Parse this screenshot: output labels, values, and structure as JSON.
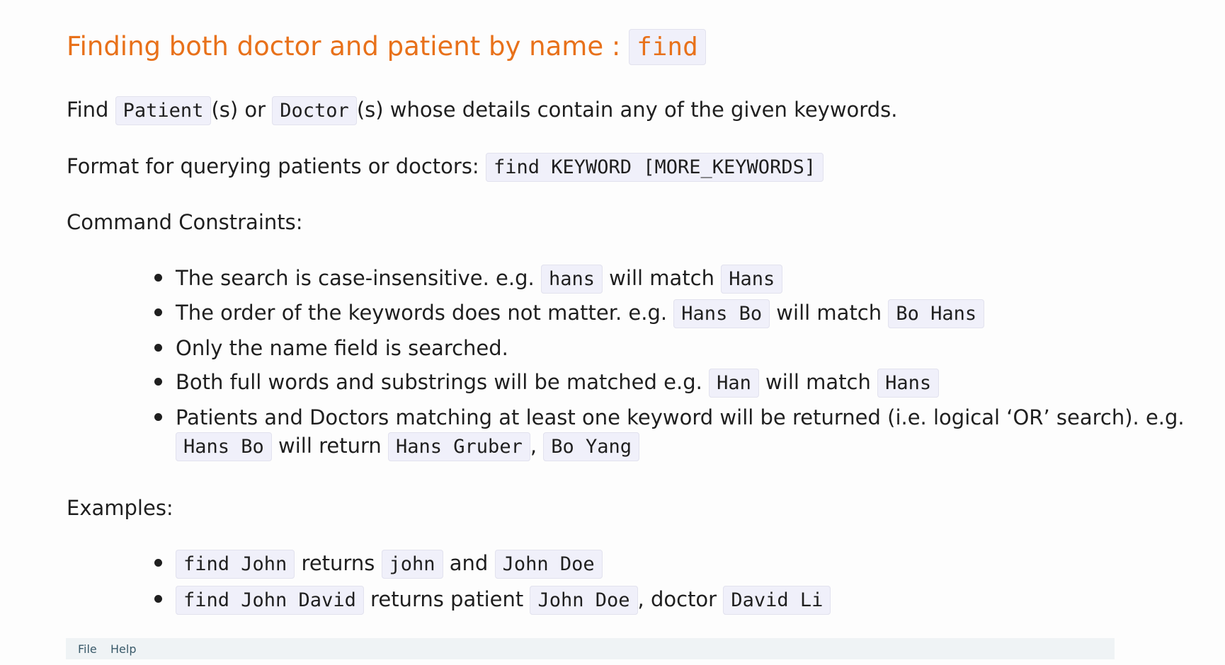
{
  "title": {
    "text": "Finding both doctor and patient by name : ",
    "code": "find"
  },
  "intro": {
    "t1": "Find ",
    "c1": "Patient",
    "t2": "(s) or ",
    "c2": "Doctor",
    "t3": "(s) whose details contain any of the given keywords."
  },
  "format": {
    "text": "Format for querying patients or doctors: ",
    "code": "find KEYWORD [MORE_KEYWORDS]"
  },
  "constraints_heading": "Command Constraints:",
  "constraints": [
    {
      "t1": "The search is case-insensitive. e.g. ",
      "c1": "hans",
      "t2": " will match ",
      "c2": "Hans"
    },
    {
      "t1": "The order of the keywords does not matter. e.g. ",
      "c1": "Hans Bo",
      "t2": " will match ",
      "c2": "Bo Hans"
    },
    {
      "t1": "Only the name field is searched."
    },
    {
      "t1": "Both full words and substrings will be matched e.g. ",
      "c1": "Han",
      "t2": " will match ",
      "c2": "Hans"
    },
    {
      "t1": "Patients and Doctors matching at least one keyword will be returned (i.e. logical ‘OR’ search). e.g.",
      "c1": "Hans Bo",
      "t2": " will return ",
      "c2": "Hans Gruber",
      "t3": ", ",
      "c3": "Bo Yang"
    }
  ],
  "examples_heading": "Examples:",
  "examples": [
    {
      "c1": "find John",
      "t1": " returns ",
      "c2": "john",
      "t2": " and ",
      "c3": "John Doe"
    },
    {
      "c1": "find John David",
      "t1": " returns patient ",
      "c2": "John Doe",
      "t2": ", doctor ",
      "c3": "David Li"
    }
  ],
  "menu": {
    "file": "File",
    "help": "Help"
  }
}
